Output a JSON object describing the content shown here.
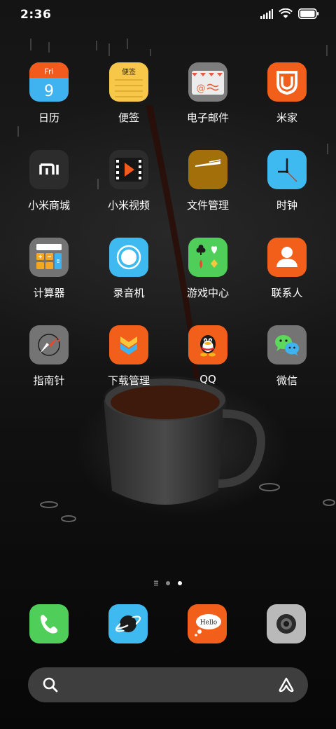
{
  "status_bar": {
    "time": "2:36"
  },
  "apps": [
    {
      "label": "日历",
      "icon": "calendar-icon",
      "day": "Fri",
      "date": "9"
    },
    {
      "label": "便签",
      "icon": "notes-icon",
      "tile_text": "便签"
    },
    {
      "label": "电子邮件",
      "icon": "email-icon"
    },
    {
      "label": "米家",
      "icon": "mijia-icon"
    },
    {
      "label": "小米商城",
      "icon": "mi-store-icon",
      "tile_text": "MI"
    },
    {
      "label": "小米视频",
      "icon": "video-icon"
    },
    {
      "label": "文件管理",
      "icon": "file-manager-icon"
    },
    {
      "label": "时钟",
      "icon": "clock-icon"
    },
    {
      "label": "计算器",
      "icon": "calculator-icon"
    },
    {
      "label": "录音机",
      "icon": "recorder-icon"
    },
    {
      "label": "游戏中心",
      "icon": "game-center-icon"
    },
    {
      "label": "联系人",
      "icon": "contacts-icon"
    },
    {
      "label": "指南针",
      "icon": "compass-icon"
    },
    {
      "label": "下载管理",
      "icon": "downloads-icon"
    },
    {
      "label": "QQ",
      "icon": "qq-icon"
    },
    {
      "label": "微信",
      "icon": "wechat-icon"
    }
  ],
  "page_indicator": {
    "pages": 2,
    "current": 2
  },
  "dock": [
    {
      "icon": "phone-icon"
    },
    {
      "icon": "browser-icon"
    },
    {
      "icon": "messages-icon",
      "tile_text": "Hello"
    },
    {
      "icon": "camera-icon"
    }
  ],
  "search_bar": {
    "left_icon": "search-icon",
    "right_icon": "assistant-icon"
  }
}
